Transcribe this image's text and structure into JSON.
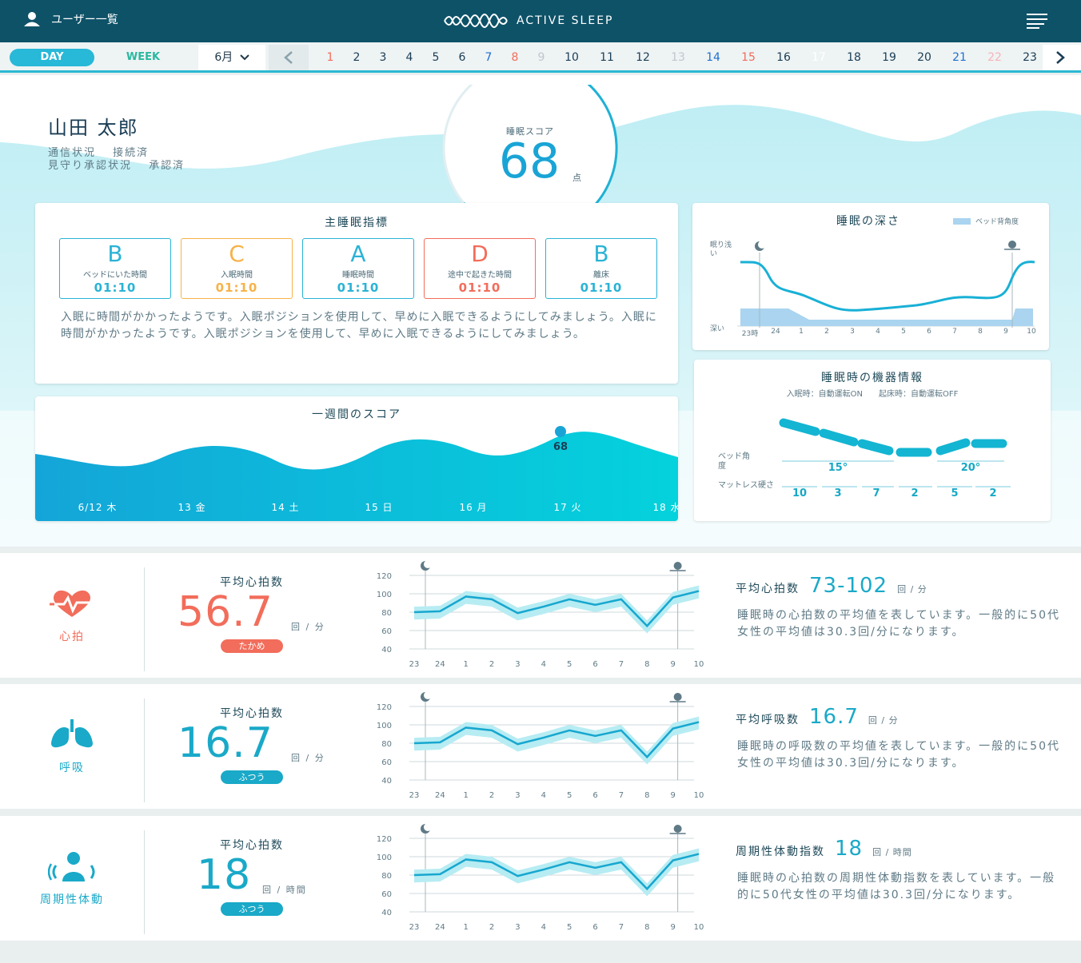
{
  "header": {
    "user_list_label": "ユーザー一覧",
    "app_name": "ACTIVE SLEEP"
  },
  "date_bar": {
    "mode_day": "DAY",
    "mode_week": "WEEK",
    "month": "6月",
    "days": [
      "1",
      "2",
      "3",
      "4",
      "5",
      "6",
      "7",
      "8",
      "9",
      "10",
      "11",
      "12",
      "13",
      "14",
      "15",
      "16",
      "17",
      "18",
      "19",
      "20",
      "21",
      "22",
      "23"
    ],
    "selected_day": "17"
  },
  "profile": {
    "name": "山田 太郎",
    "connection_label": "通信状況",
    "connection_value": "接続済",
    "approval_label": "見守り承認状況",
    "approval_value": "承認済"
  },
  "score": {
    "label": "睡眠スコア",
    "value": "68",
    "unit": "点"
  },
  "main_indices": {
    "title": "主睡眠指標",
    "items": [
      {
        "grade": "B",
        "label": "ベッドにいた時間",
        "time": "01:10",
        "color": "#2ab3d6"
      },
      {
        "grade": "C",
        "label": "入眠時間",
        "time": "01:10",
        "color": "#f7b24a"
      },
      {
        "grade": "A",
        "label": "睡眠時間",
        "time": "01:10",
        "color": "#2ab3d6"
      },
      {
        "grade": "D",
        "label": "途中で起きた時間",
        "time": "01:10",
        "color": "#f26d5b"
      },
      {
        "grade": "B",
        "label": "離床",
        "time": "01:10",
        "color": "#2ab3d6"
      }
    ],
    "advice": "入眠に時間がかかったようです。入眠ポジションを使用して、早めに入眠できるようにしてみましょう。入眠に時間がかかったようです。入眠ポジションを使用して、早めに入眠できるようにしてみましょう。"
  },
  "weekly": {
    "title": "一週間のスコア",
    "days": [
      "6/12 木",
      "13 金",
      "14 土",
      "15 日",
      "16 月",
      "17 火",
      "18 水"
    ],
    "selected_score": "68"
  },
  "sleep_depth": {
    "title": "睡眠の深さ",
    "legend": "ベッド背角度",
    "y_top": "眠り浅い",
    "y_bottom": "深い",
    "x_labels": [
      "23時",
      "24",
      "1",
      "2",
      "3",
      "4",
      "5",
      "6",
      "7",
      "8",
      "9",
      "10"
    ]
  },
  "device": {
    "title": "睡眠時の機器情報",
    "subtitle": "入眠時：自動運転ON　　起床時：自動運転OFF",
    "angle_label": "ベッド角度",
    "angles": [
      "15°",
      "20°"
    ],
    "mattress_label": "マットレス硬さ",
    "hardness": [
      "10",
      "3",
      "7",
      "2",
      "5",
      "2"
    ]
  },
  "chart_x_labels": [
    "23",
    "24",
    "1",
    "2",
    "3",
    "4",
    "5",
    "6",
    "7",
    "8",
    "9",
    "10"
  ],
  "chart_y_labels": [
    "120",
    "100",
    "80",
    "60",
    "40"
  ],
  "metrics": [
    {
      "icon_label": "心拍",
      "title": "平均心拍数",
      "value": "56.7",
      "unit": "回 / 分",
      "badge": "たかめ",
      "color": "#f26d5b",
      "head_title": "平均心拍数",
      "head_value": "73-102",
      "head_unit": "回 / 分",
      "desc": "睡眠時の心拍数の平均値を表しています。一般的に50代女性の平均値は30.3回/分になります。"
    },
    {
      "icon_label": "呼吸",
      "title": "平均心拍数",
      "value": "16.7",
      "unit": "回 / 分",
      "badge": "ふつう",
      "color": "#1aa9c8",
      "head_title": "平均呼吸数",
      "head_value": "16.7",
      "head_unit": "回 / 分",
      "desc": "睡眠時の呼吸数の平均値を表しています。一般的に50代女性の平均値は30.3回/分になります。"
    },
    {
      "icon_label": "周期性体動",
      "title": "平均心拍数",
      "value": "18",
      "unit": "回 / 時間",
      "badge": "ふつう",
      "color": "#1aa9c8",
      "head_title": "周期性体動指数",
      "head_value": "18",
      "head_unit": "回 / 時間",
      "desc": "睡眠時の心拍数の周期性体動指数を表しています。一般的に50代女性の平均値は30.3回/分になります。"
    }
  ],
  "chart_data": {
    "type": "line",
    "x": [
      "23",
      "24",
      "1",
      "2",
      "3",
      "4",
      "5",
      "6",
      "7",
      "8",
      "9",
      "10"
    ],
    "ylim": [
      40,
      120
    ],
    "series": [
      {
        "values": [
          80,
          81,
          97,
          94,
          79,
          86,
          94,
          88,
          94,
          65,
          96,
          103
        ]
      }
    ]
  }
}
